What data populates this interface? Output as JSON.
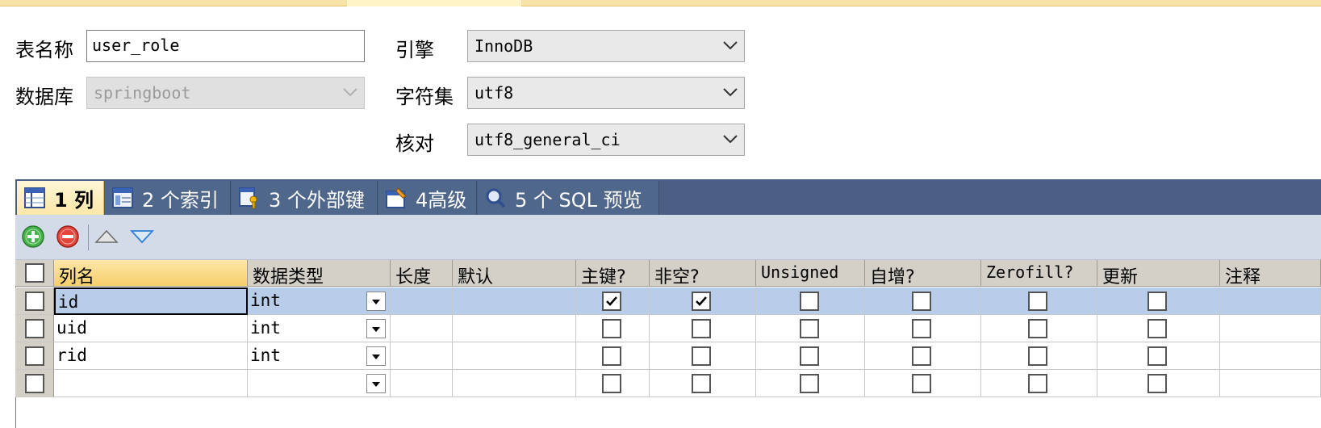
{
  "form": {
    "table_name_label": "表名称",
    "table_name_value": "user_role",
    "database_label": "数据库",
    "database_value": "springboot",
    "engine_label": "引擎",
    "engine_value": "InnoDB",
    "charset_label": "字符集",
    "charset_value": "utf8",
    "collation_label": "核对",
    "collation_value": "utf8_general_ci"
  },
  "tabs": [
    {
      "label": "1 列",
      "icon": "columns-icon"
    },
    {
      "label": "2 个索引",
      "icon": "index-icon"
    },
    {
      "label": "3 个外部键",
      "icon": "foreign-key-icon"
    },
    {
      "label": "4高级",
      "icon": "advanced-icon"
    },
    {
      "label": "5 个 SQL 预览",
      "icon": "sql-preview-icon"
    }
  ],
  "toolbar": {
    "add_icon": "add-icon",
    "remove_icon": "remove-icon",
    "up_icon": "move-up-icon",
    "down_icon": "move-down-icon"
  },
  "grid": {
    "headers": [
      "列名",
      "数据类型",
      "长度",
      "默认",
      "主键?",
      "非空?",
      "Unsigned",
      "自增?",
      "Zerofill?",
      "更新",
      "注释"
    ],
    "rows": [
      {
        "name": "id",
        "type": "int",
        "length": "",
        "default": "",
        "pk": true,
        "notnull": true,
        "unsigned": false,
        "autoinc": false,
        "zerofill": false,
        "update": false
      },
      {
        "name": "uid",
        "type": "int",
        "length": "",
        "default": "",
        "pk": false,
        "notnull": false,
        "unsigned": false,
        "autoinc": false,
        "zerofill": false,
        "update": false
      },
      {
        "name": "rid",
        "type": "int",
        "length": "",
        "default": "",
        "pk": false,
        "notnull": false,
        "unsigned": false,
        "autoinc": false,
        "zerofill": false,
        "update": false
      },
      {
        "name": "",
        "type": "",
        "length": "",
        "default": "",
        "pk": false,
        "notnull": false,
        "unsigned": false,
        "autoinc": false,
        "zerofill": false,
        "update": false
      }
    ]
  }
}
